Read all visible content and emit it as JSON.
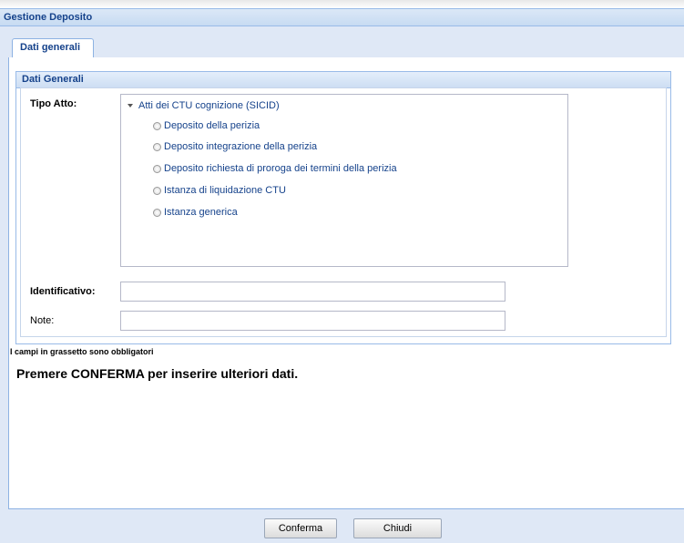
{
  "window": {
    "title": "Gestione Deposito"
  },
  "tabs": [
    {
      "label": "Dati generali",
      "active": true
    }
  ],
  "section": {
    "title": "Dati Generali"
  },
  "form": {
    "tipo_atto_label": "Tipo Atto:",
    "tree_root_label": "Atti dei CTU cognizione (SICID)",
    "options": [
      {
        "label": "Deposito della perizia",
        "selected": false
      },
      {
        "label": "Deposito integrazione della perizia",
        "selected": false
      },
      {
        "label": "Deposito richiesta di proroga dei termini della perizia",
        "selected": false
      },
      {
        "label": "Istanza di liquidazione CTU",
        "selected": false
      },
      {
        "label": "Istanza generica",
        "selected": false
      }
    ],
    "identificativo_label": "Identificativo:",
    "identificativo_value": "",
    "note_label": "Note:",
    "note_value": ""
  },
  "hints": {
    "required_note": "I campi in grassetto sono obbligatori",
    "confirm_message": "Premere CONFERMA per inserire ulteriori dati."
  },
  "buttons": {
    "confirm": "Conferma",
    "close": "Chiudi"
  },
  "colors": {
    "header_text": "#15428b",
    "border": "#99bbe8",
    "window_bg": "#dfe8f6"
  }
}
